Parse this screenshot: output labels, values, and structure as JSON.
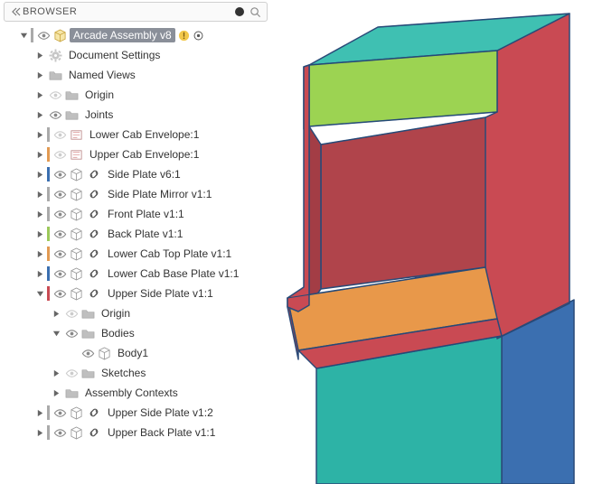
{
  "panel": {
    "title": "BROWSER"
  },
  "root": {
    "label": "Arcade Assembly v8"
  },
  "items": {
    "doc_settings": "Document Settings",
    "named_views": "Named Views",
    "origin": "Origin",
    "joints": "Joints",
    "lower_cab_env": "Lower Cab Envelope:1",
    "upper_cab_env": "Upper Cab Envelope:1",
    "side_plate": "Side Plate v6:1",
    "side_plate_mirror": "Side Plate Mirror v1:1",
    "front_plate": "Front Plate v1:1",
    "back_plate": "Back Plate v1:1",
    "lower_cab_top": "Lower Cab Top Plate v1:1",
    "lower_cab_base": "Lower Cab Base Plate v1:1",
    "upper_side_plate": "Upper Side Plate v1:1",
    "usp_origin": "Origin",
    "usp_bodies": "Bodies",
    "usp_body1": "Body1",
    "usp_sketches": "Sketches",
    "usp_asm_ctx": "Assembly Contexts",
    "upper_side_plate2": "Upper Side Plate v1:2",
    "upper_back_plate": "Upper Back Plate v1:1"
  },
  "colors": {
    "teal": "#2db3a6",
    "red": "#c94a53",
    "blue": "#3b6fb0",
    "orange": "#e29a52",
    "green": "#9cc95a",
    "edge": "#3a5a8a",
    "floor": "#d98a3a"
  }
}
